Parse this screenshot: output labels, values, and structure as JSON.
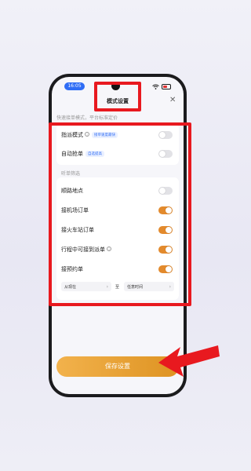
{
  "status": {
    "time": "16:05"
  },
  "header": {
    "title": "模式设置"
  },
  "subheader": "快速接单模式，平台标准定价",
  "mode_section": {
    "items": [
      {
        "label": "指派模式",
        "tag": "接单速度最快",
        "on": false
      },
      {
        "label": "自动抢单",
        "tag": "自选提高",
        "on": false
      }
    ]
  },
  "filter_section": {
    "title": "听单筛选",
    "items": [
      {
        "label": "顺路地点",
        "on": false
      },
      {
        "label": "接机场订单",
        "on": true
      },
      {
        "label": "接火车站订单",
        "on": true
      },
      {
        "label": "行程中可接到派单",
        "on": true
      },
      {
        "label": "接预约单",
        "on": true
      }
    ],
    "time_range": {
      "from": "从现在",
      "to_label": "至",
      "to": "任意时间"
    }
  },
  "save_label": "保存设置",
  "colors": {
    "accent": "#e38a2c",
    "toggle_off": "#e2e2e6",
    "annotation": "#e8191f",
    "blue": "#2f6df5"
  }
}
